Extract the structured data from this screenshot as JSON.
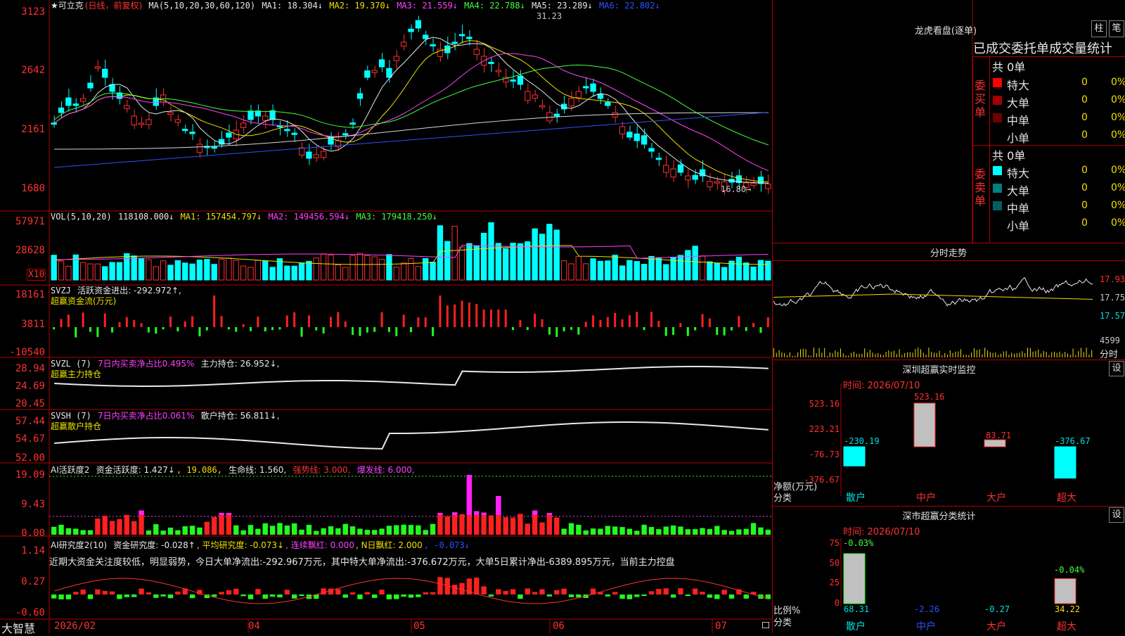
{
  "main": {
    "title_prefix": "★可立克",
    "period": "(日线，前复权)",
    "ma_params": "MA(5,10,20,30,60,120)",
    "ma": [
      {
        "label": "MA1: 18.304↓",
        "color": "#e8e8e8"
      },
      {
        "label": "MA2: 19.370↓",
        "color": "#f0e000"
      },
      {
        "label": "MA3: 21.559↓",
        "color": "#ff40ff"
      },
      {
        "label": "MA4: 22.788↓",
        "color": "#40ff40"
      },
      {
        "label": "MA5: 23.289↓",
        "color": "#e8e8e8"
      },
      {
        "label": "MA6: 22.802↓",
        "color": "#3050ff"
      }
    ],
    "y_ticks": [
      "3123",
      "2642",
      "2161",
      "1680"
    ],
    "high_label": "31.23",
    "low_label": "16.80→"
  },
  "volume": {
    "legend": "VOL(5,10,20)",
    "value": "118108.000↓",
    "ma": [
      {
        "label": "MA1: 157454.797↓",
        "color": "#e8e8e8"
      },
      {
        "label": "MA2: 149456.594↓",
        "color": "#f0e000"
      },
      {
        "label": "MA3: 179418.250↓",
        "color": "#ff40ff"
      }
    ],
    "y_ticks": [
      "57971",
      "28628"
    ],
    "unit": "X10"
  },
  "svzj": {
    "legend": "SVZJ",
    "active_label": "活跃资金进出: -292.972↑,",
    "sub_label": "超赢资金流(万元)",
    "y_ticks": [
      "18161",
      "3811",
      "-10540"
    ]
  },
  "svzl": {
    "legend": "SVZL (7)",
    "ratio": "7日内买卖净占比0.495%",
    "hold": "主力持仓: 26.952↓,",
    "sub_label": "超赢主力持仓",
    "y_ticks": [
      "28.94",
      "24.69",
      "20.45"
    ]
  },
  "svsh": {
    "legend": "SVSH (7)",
    "ratio": "7日内买卖净占比0.061%",
    "hold": "散户持仓: 56.811↓,",
    "sub_label": "超赢散户持仓",
    "y_ticks": [
      "57.44",
      "54.67",
      "52.00"
    ]
  },
  "ai_active": {
    "legend": "AI活跃度2",
    "items": [
      {
        "label": "资金活跃度: 1.427↓",
        "color": "#e8e8e8"
      },
      {
        "label": ", 19.086,",
        "color": "#f0e000"
      },
      {
        "label": "生命线: 1.560,",
        "color": "#e8e8e8"
      },
      {
        "label": "强势线: 3.000,",
        "color": "#ff3030"
      },
      {
        "label": "爆发线: 6.000,",
        "color": "#ff40ff"
      }
    ],
    "y_ticks": [
      "19.09",
      "9.43",
      "0.00"
    ]
  },
  "ai_research": {
    "legend": "AI研究度2(10)",
    "items": [
      {
        "label": "资金研究度: -0.028↑",
        "color": "#e8e8e8"
      },
      {
        "label": ", 平均研究度: -0.073↓",
        "color": "#f0e000"
      },
      {
        "label": ", 连续飘红: 0.000",
        "color": "#ff40ff"
      },
      {
        "label": ", N日飘红: 2.000",
        "color": "#f0e000"
      },
      {
        "label": ", -0.073↓",
        "color": "#3050ff"
      }
    ],
    "comment": "近期大资金关注度较低，明显弱势，今日大单净流出:-292.967万元，其中特大单净流出:-376.672万元，大单5日累计净出-6389.895万元，当前主力控盘",
    "y_ticks": [
      "1.14",
      "0.27",
      "-0.60"
    ]
  },
  "x_axis": {
    "labels": [
      "2026/02",
      "04",
      "05",
      "06",
      "07"
    ],
    "brand": "大智慧"
  },
  "lhb": {
    "title": "龙虎看盘(逐单)",
    "btn_bar": "柱",
    "btn_pen": "笔",
    "header": "已成交委托单成交量统计",
    "buy_label": "委买单",
    "sell_label": "委卖单",
    "buy_total": "共 0单",
    "sell_total": "共 0单",
    "buy_rows": [
      {
        "name": "特大",
        "count": "0",
        "pct": "0%",
        "color": "#ff0000"
      },
      {
        "name": "大单",
        "count": "0",
        "pct": "0%",
        "color": "#a00000"
      },
      {
        "name": "中单",
        "count": "0",
        "pct": "0%",
        "color": "#700000"
      },
      {
        "name": "小单",
        "count": "0",
        "pct": "0%",
        "color": "#000000"
      }
    ],
    "sell_rows": [
      {
        "name": "特大",
        "count": "0",
        "pct": "0%",
        "color": "#00ffff"
      },
      {
        "name": "大单",
        "count": "0",
        "pct": "0%",
        "color": "#008080"
      },
      {
        "name": "中单",
        "count": "0",
        "pct": "0%",
        "color": "#006060"
      },
      {
        "name": "小单",
        "count": "0",
        "pct": "0%",
        "color": "#000000"
      }
    ]
  },
  "intraday": {
    "title": "分时走势",
    "y_labels": [
      "17.93",
      "17.75",
      "17.57"
    ],
    "vol_label": "4599",
    "time_label": "分时"
  },
  "sz_monitor": {
    "title": "深圳超赢实时监控",
    "btn": "设",
    "time": "时间: 2026/07/10",
    "y_ticks": [
      "523.16",
      "223.21",
      "-76.73",
      "-376.67"
    ],
    "axis_name": "净额(万元)",
    "axis_cat": "分类",
    "categories": [
      "散户",
      "中户",
      "大户",
      "超大"
    ],
    "values": [
      -230.19,
      523.16,
      83.71,
      -376.67
    ],
    "value_labels": [
      "-230.19",
      "523.16",
      "83.71",
      "-376.67"
    ]
  },
  "sz_class": {
    "title": "深市超赢分类统计",
    "btn": "设",
    "time": "时间: 2026/07/10",
    "y_ticks": [
      "75",
      "50",
      "25",
      "0"
    ],
    "axis_name": "比例%",
    "axis_cat": "分类",
    "categories": [
      "散户",
      "中户",
      "大户",
      "超大"
    ],
    "values": [
      68.31,
      -2.26,
      -0.27,
      34.22
    ],
    "value_labels": [
      "68.31",
      "-2.26",
      "-0.27",
      "34.22"
    ],
    "change_labels": [
      "-0.03%",
      "-0.04%"
    ]
  },
  "colors": {
    "up": "#ff3030",
    "down": "#00ffff",
    "frame": "#b00000",
    "text_yellow": "#f0e000"
  }
}
